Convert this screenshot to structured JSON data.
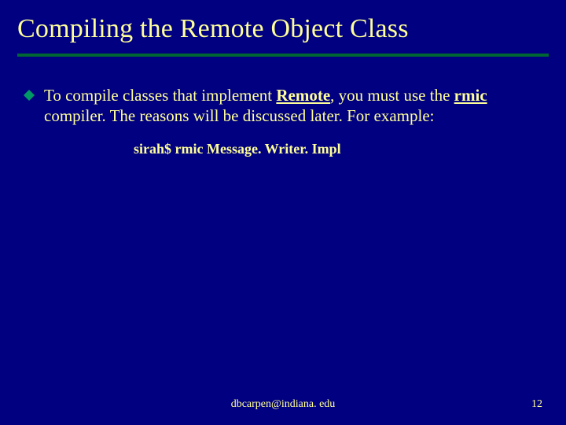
{
  "title": "Compiling the Remote Object Class",
  "bullet": {
    "pre1": "To compile classes that implement ",
    "kw1": "Remote",
    "mid1": ", you must use the ",
    "kw2": "rmic",
    "post1": " compiler.  The reasons will be discussed later.  For example:"
  },
  "code": "sirah$  rmic Message. Writer. Impl",
  "footer_email": "dbcarpen@indiana. edu",
  "page_number": "12"
}
